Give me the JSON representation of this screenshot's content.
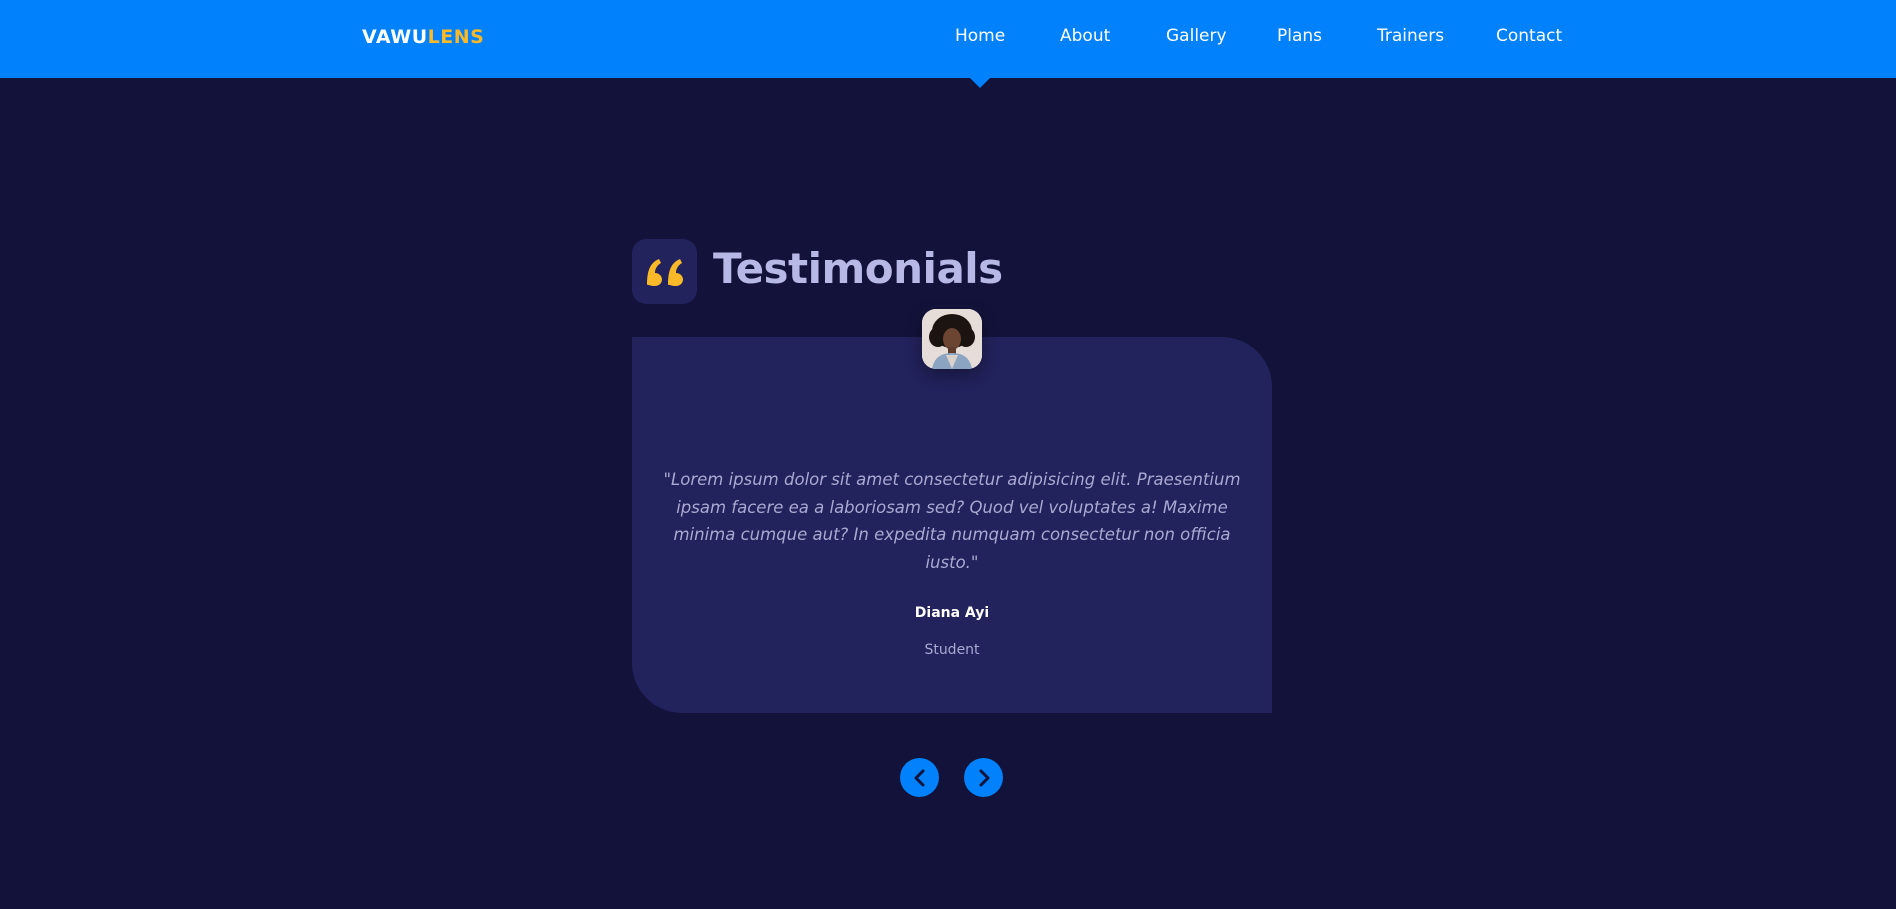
{
  "header": {
    "logo_part1": "VAWU",
    "logo_part2": "LENS",
    "nav": [
      "Home",
      "About",
      "Gallery",
      "Plans",
      "Trainers",
      "Contact"
    ],
    "active_item": "Home"
  },
  "section": {
    "title": "Testimonials",
    "title_icon": "quote-icon"
  },
  "testimonial": {
    "quote": "\"Lorem ipsum dolor sit amet consectetur adipisicing elit. Praesentium ipsam facere ea a laboriosam sed? Quod vel voluptates a! Maxime minima cumque aut? In expedita numquam consectetur non officia iusto.\"",
    "name": "Diana Ayi",
    "role": "Student"
  },
  "controls": {
    "prev_icon": "chevron-left-icon",
    "next_icon": "chevron-right-icon"
  },
  "colors": {
    "primary": "#0181fb",
    "accent": "#f9b928",
    "background": "#13123a",
    "card": "#22225c",
    "title": "#b8b8e6"
  }
}
